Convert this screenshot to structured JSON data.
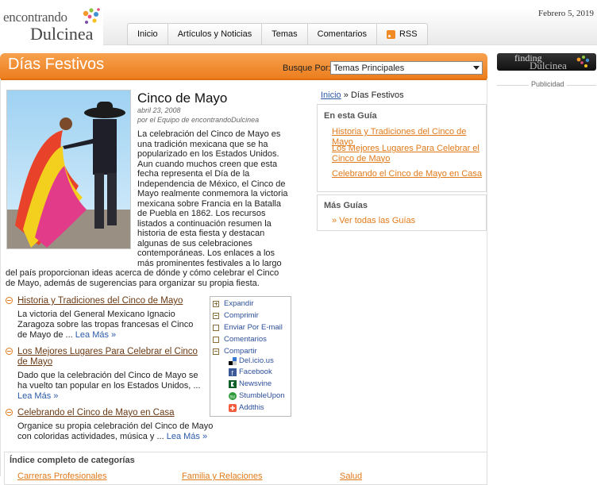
{
  "header": {
    "logo_top": "encontrando",
    "logo_bottom": "Dulcinea",
    "date": "Febrero 5, 2019",
    "nav": [
      "Inicio",
      "Artículos y Noticias",
      "Temas",
      "Comentarios",
      "RSS"
    ]
  },
  "section": {
    "title": "Días Festivos",
    "search_label": "Busque Por:",
    "search_value": "Temas Principales"
  },
  "article": {
    "title": "Cinco de Mayo",
    "date": "abril 23, 2008",
    "byline": "por el Equipo de encontrandoDulcinea",
    "body": "La celebración del Cinco de Mayo es una tradición mexicana que se ha popularizado en los Estados Unidos. Aun cuando muchos creen que esta fecha representa el Día de la Independencia de México, el Cinco de Mayo realmente conmemora la victoria mexicana sobre Francia en la Batalla de Puebla en 1862. Los recursos listados a continuación resumen la historia de esta fiesta y destacan algunas de sus celebraciones contemporáneas. Los enlaces a los más prominentes festivales a lo largo del país proporcionan ideas acerca de dónde y cómo celebrar el Cinco de Mayo, además de sugerencias para organizar su propia fiesta."
  },
  "guides": [
    {
      "title": "Historia y Tradiciones del Cinco de Mayo",
      "desc": "La victoria del General Mexicano Ignacio Zaragoza sobre las tropas francesas el Cinco de Mayo de ...",
      "more": "Lea Más »"
    },
    {
      "title": "Los Mejores Lugares Para Celebrar el Cinco de Mayo",
      "desc": "Dado que la celebración del Cinco de Mayo se ha vuelto tan popular en los Estados Unidos, ...",
      "more": "Lea Más »"
    },
    {
      "title": "Celebrando el Cinco de Mayo en Casa",
      "desc": "Organice su propia celebración del Cinco de Mayo con coloridas actividades, música y ...",
      "more": "Lea Más »"
    }
  ],
  "share": {
    "expand": "Expandir",
    "print": "Comprimir",
    "email": "Enviar Por E-mail",
    "comments": "Comentarios",
    "share": "Compartir",
    "sites": [
      "Del.icio.us",
      "Facebook",
      "Newsvine",
      "StumbleUpon",
      "Addthis"
    ]
  },
  "sidebar": {
    "breadcrumb_home": "Inicio",
    "breadcrumb_sep": "»",
    "breadcrumb_current": "Días Festivos",
    "guide_heading": "En esta Guía",
    "guide_links": [
      "Historia y Tradiciones del Cinco de Mayo",
      "Los Mejores Lugares Para Celebrar el Cinco de Mayo",
      "Celebrando el Cinco de Mayo en Casa"
    ],
    "more_heading": "Más Guías",
    "more_link": "» Ver todas las Guías"
  },
  "footer": {
    "title": "Índice completo de categorías",
    "categories": [
      "Carreras Profesionales",
      "Familia y Relaciones",
      "Salud"
    ]
  },
  "right": {
    "logo_top": "finding",
    "logo_bottom": "Dulcinea",
    "publicidad": "Publicidad"
  }
}
